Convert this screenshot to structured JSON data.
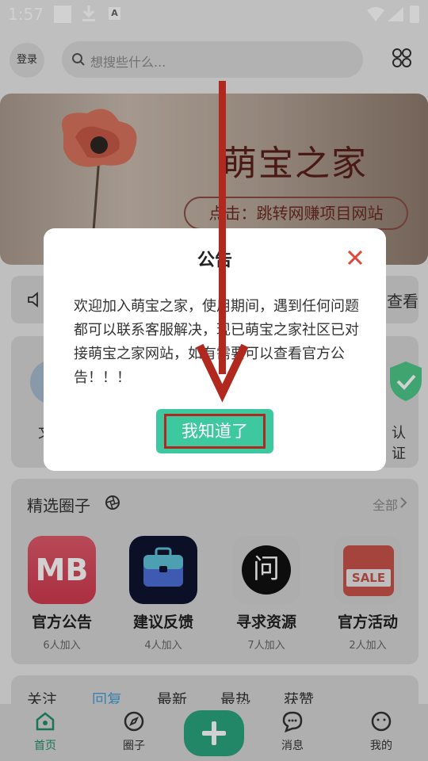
{
  "status_bar": {
    "time": "1:57"
  },
  "header": {
    "login_label": "登录",
    "search_placeholder": "想搜些什么..."
  },
  "banner": {
    "title": "萌宝之家",
    "pill": "点击：跳转网赚项目网站"
  },
  "notice": {
    "more_label": "查看"
  },
  "entries": {
    "left_label": "文",
    "right_label": "认证"
  },
  "circles": {
    "title": "精选圈子",
    "all_label": "全部",
    "items": [
      {
        "name": "官方公告",
        "count": "6人加入",
        "thumb_text": "MB"
      },
      {
        "name": "建议反馈",
        "count": "4人加入"
      },
      {
        "name": "寻求资源",
        "count": "7人加入",
        "thumb_text": "问"
      },
      {
        "name": "官方活动",
        "count": "2人加入",
        "thumb_text": "SALE"
      }
    ]
  },
  "feed_tabs": [
    {
      "label": "关注",
      "active": false
    },
    {
      "label": "回复",
      "active": true
    },
    {
      "label": "最新",
      "active": false
    },
    {
      "label": "最热",
      "active": false
    },
    {
      "label": "获赞",
      "active": false
    }
  ],
  "bottom_nav": [
    {
      "label": "首页",
      "icon": "home-icon",
      "active": true
    },
    {
      "label": "圈子",
      "icon": "compass-icon",
      "active": false
    },
    {
      "label": "消息",
      "icon": "chat-icon",
      "active": false
    },
    {
      "label": "我的",
      "icon": "profile-icon",
      "active": false
    }
  ],
  "dialog": {
    "title": "公告",
    "body": "欢迎加入萌宝之家，使用期间，遇到任何问题都可以联系客服解决，现已萌宝之家社区已对接萌宝之家网站，如有需要可以查看官方公告！！！",
    "ok_label": "我知道了"
  },
  "colors": {
    "accent": "#29a57d",
    "dialog_button": "#3ec8a0",
    "highlight_red": "#b0281e",
    "close_red": "#e0453a",
    "active_tab": "#4a9fd5"
  }
}
